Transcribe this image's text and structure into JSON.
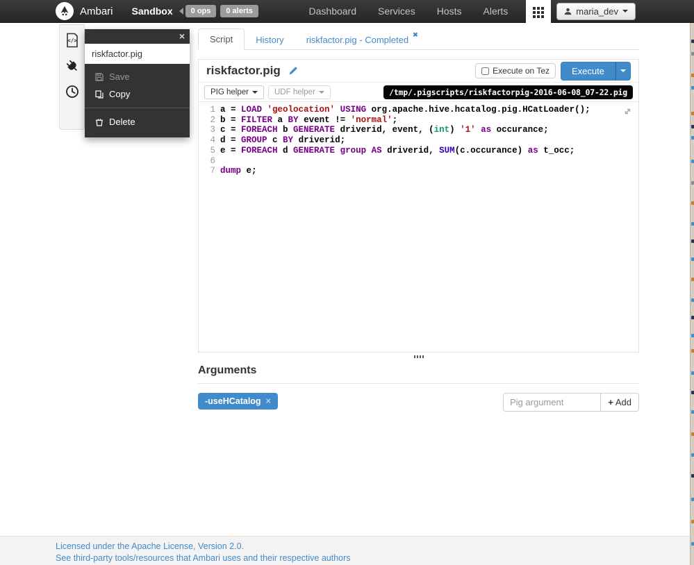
{
  "navbar": {
    "brand": "Ambari",
    "cluster_name": "Sandbox",
    "badges": [
      {
        "label": "0 ops"
      },
      {
        "label": "0 alerts"
      }
    ],
    "links": [
      "Dashboard",
      "Services",
      "Hosts",
      "Alerts"
    ],
    "user_label": "maria_dev"
  },
  "sidebar": {
    "filename": "riskfactor.pig",
    "menu": {
      "save": "Save",
      "copy": "Copy",
      "delete": "Delete"
    }
  },
  "tabs": [
    {
      "label": "Script"
    },
    {
      "label": "History"
    },
    {
      "label": "riskfactor.pig - Completed"
    }
  ],
  "script": {
    "title": "riskfactor.pig",
    "execute_on_tez_label": "Execute on Tez",
    "execute_label": "Execute",
    "pig_helper_label": "PIG helper",
    "udf_helper_label": "UDF helper",
    "path": "/tmp/.pigscripts/riskfactorpig-2016-06-08_07-22.pig",
    "code_lines": [
      [
        [
          "pl",
          "a = "
        ],
        [
          "kw",
          "LOAD"
        ],
        [
          "pl",
          " "
        ],
        [
          "str",
          "'geolocation'"
        ],
        [
          "pl",
          " "
        ],
        [
          "kw",
          "USING"
        ],
        [
          "pl",
          " org.apache.hive.hcatalog.pig.HCatLoader();"
        ]
      ],
      [
        [
          "pl",
          "b = "
        ],
        [
          "kw",
          "FILTER"
        ],
        [
          "pl",
          " a "
        ],
        [
          "kw",
          "BY"
        ],
        [
          "pl",
          " event != "
        ],
        [
          "str",
          "'normal'"
        ],
        [
          "pl",
          ";"
        ]
      ],
      [
        [
          "pl",
          "c = "
        ],
        [
          "kw",
          "FOREACH"
        ],
        [
          "pl",
          " b "
        ],
        [
          "kw",
          "GENERATE"
        ],
        [
          "pl",
          " driverid, event, ("
        ],
        [
          "typ",
          "int"
        ],
        [
          "pl",
          ") "
        ],
        [
          "str",
          "'1'"
        ],
        [
          "pl",
          " "
        ],
        [
          "kw",
          "as"
        ],
        [
          "pl",
          " occurance;"
        ]
      ],
      [
        [
          "pl",
          "d = "
        ],
        [
          "kw",
          "GROUP"
        ],
        [
          "pl",
          " c "
        ],
        [
          "kw",
          "BY"
        ],
        [
          "pl",
          " driverid;"
        ]
      ],
      [
        [
          "pl",
          "e = "
        ],
        [
          "kw",
          "FOREACH"
        ],
        [
          "pl",
          " d "
        ],
        [
          "kw",
          "GENERATE"
        ],
        [
          "pl",
          " "
        ],
        [
          "kw",
          "group"
        ],
        [
          "pl",
          " "
        ],
        [
          "kw",
          "AS"
        ],
        [
          "pl",
          " driverid, "
        ],
        [
          "fn",
          "SUM"
        ],
        [
          "pl",
          "(c.occurance) "
        ],
        [
          "kw",
          "as"
        ],
        [
          "pl",
          " t_occ;"
        ]
      ],
      [],
      [
        [
          "kw",
          "dump"
        ],
        [
          "pl",
          " e;"
        ]
      ]
    ]
  },
  "arguments": {
    "heading": "Arguments",
    "tags": [
      "-useHCatalog"
    ],
    "input_placeholder": "Pig argument",
    "add_label": "Add"
  },
  "footer": {
    "links": [
      "Licensed under the Apache License, Version 2.0.",
      "See third-party tools/resources that Ambari uses and their respective authors"
    ]
  },
  "colors": {
    "accent_blue": "#428bca",
    "navbar_bg": "#2f2f2f",
    "badge_gray": "#9b9b9b",
    "code_keyword": "#770088",
    "code_string": "#aa1111",
    "code_type": "#119977",
    "code_builtin": "#3300aa",
    "path_badge_bg": "#060606"
  }
}
